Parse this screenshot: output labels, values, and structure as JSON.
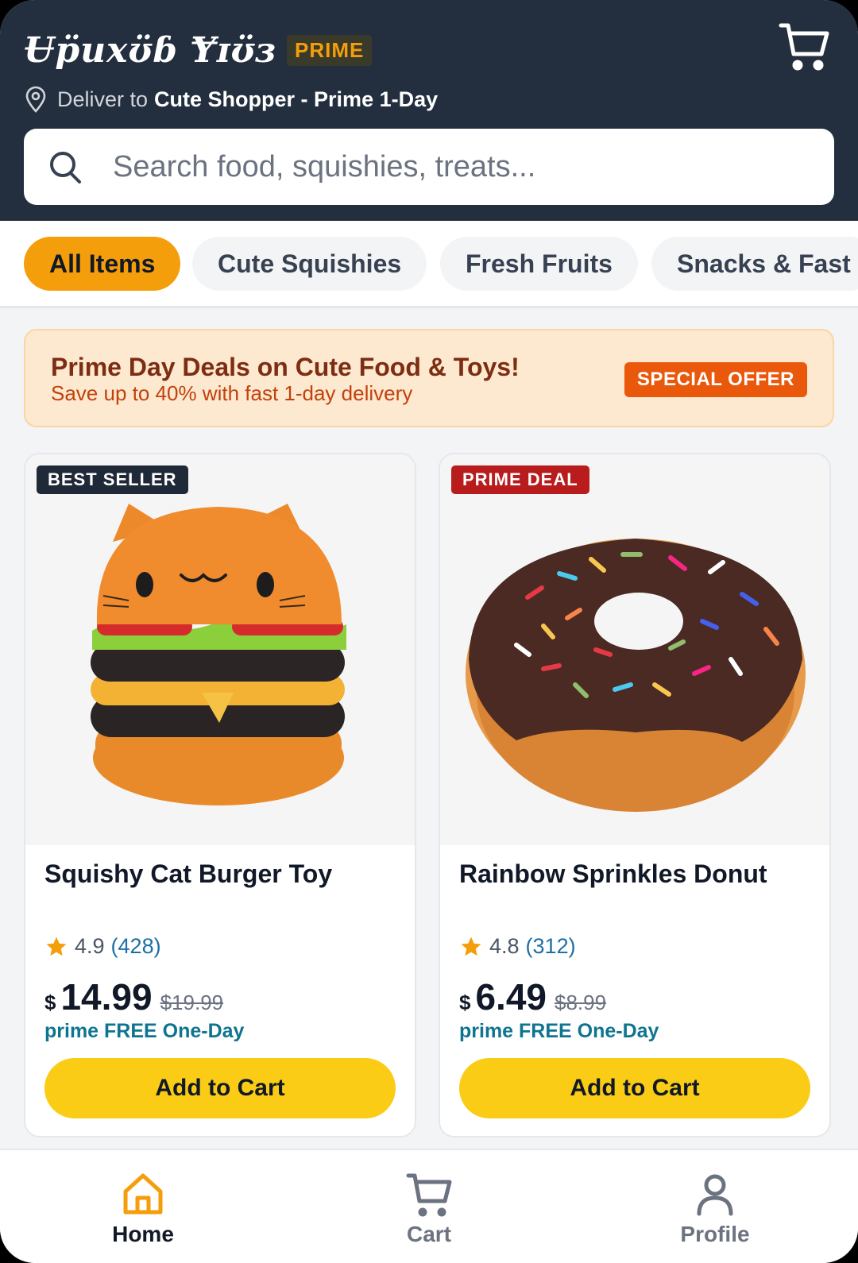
{
  "header": {
    "brand": "Ʉp̈uxʊ̈ɓ Ɏɪʊ̈ɜ",
    "prime_label": "PRIME",
    "deliver_prefix": "Deliver to",
    "deliver_target": "Cute Shopper - Prime 1-Day",
    "cart_icon": "cart-icon",
    "location_icon": "location-pin-icon"
  },
  "search": {
    "placeholder": "Search food, squishies, treats...",
    "icon": "search-icon"
  },
  "categories": [
    {
      "label": "All Items",
      "active": true
    },
    {
      "label": "Cute Squishies",
      "active": false
    },
    {
      "label": "Fresh Fruits",
      "active": false
    },
    {
      "label": "Snacks & Fast",
      "active": false
    }
  ],
  "banner": {
    "title": "Prime Day Deals on Cute Food & Toys!",
    "subtitle": "Save up to 40% with fast 1-day delivery",
    "offer_label": "SPECIAL OFFER"
  },
  "products": [
    {
      "badge": "BEST SELLER",
      "name": "Squishy Cat Burger Toy",
      "rating": "4.9",
      "reviews": "(428)",
      "currency": "$",
      "price": "14.99",
      "old_price": "$19.99",
      "shipping": "prime FREE One-Day",
      "cta": "Add to Cart"
    },
    {
      "badge": "PRIME DEAL",
      "name": "Rainbow Sprinkles Donut",
      "rating": "4.8",
      "reviews": "(312)",
      "currency": "$",
      "price": "6.49",
      "old_price": "$8.99",
      "shipping": "prime FREE One-Day",
      "cta": "Add to Cart"
    }
  ],
  "bottom_nav": [
    {
      "label": "Home",
      "icon": "home-icon",
      "active": true
    },
    {
      "label": "Cart",
      "icon": "cart-icon",
      "active": false
    },
    {
      "label": "Profile",
      "icon": "profile-icon",
      "active": false
    }
  ],
  "colors": {
    "header_bg": "#232f3e",
    "accent": "#f59e0b",
    "cta": "#facc15",
    "prime_link": "#0e7490"
  }
}
